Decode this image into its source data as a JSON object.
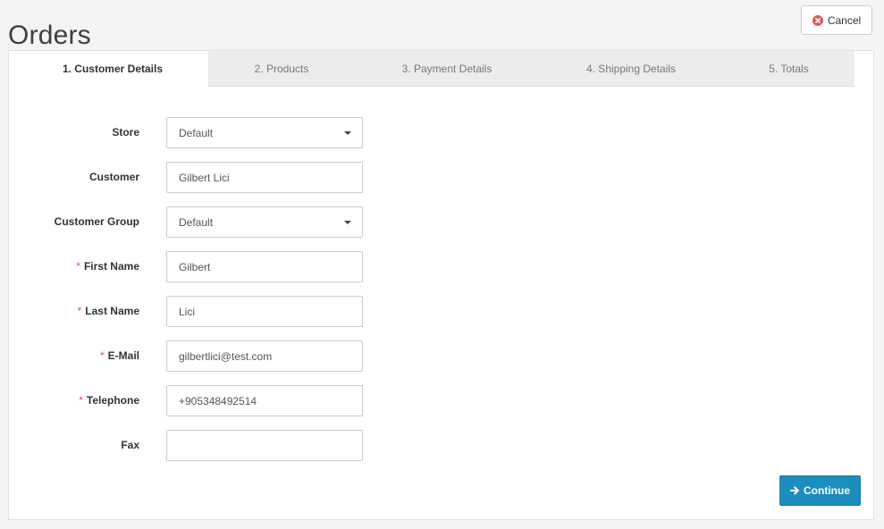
{
  "page": {
    "title": "Orders"
  },
  "header": {
    "cancel_label": "Cancel"
  },
  "tabs": [
    {
      "label": "1. Customer Details",
      "active": true
    },
    {
      "label": "2. Products",
      "active": false
    },
    {
      "label": "3. Payment Details",
      "active": false
    },
    {
      "label": "4. Shipping Details",
      "active": false
    },
    {
      "label": "5. Totals",
      "active": false
    }
  ],
  "form": {
    "store": {
      "label": "Store",
      "value": "Default",
      "required": false
    },
    "customer": {
      "label": "Customer",
      "value": "Gilbert Lici",
      "required": false
    },
    "customer_group": {
      "label": "Customer Group",
      "value": "Default",
      "required": false
    },
    "first_name": {
      "label": "First Name",
      "value": "Gilbert",
      "required": true
    },
    "last_name": {
      "label": "Last Name",
      "value": "Lici",
      "required": true
    },
    "email": {
      "label": "E-Mail",
      "value": "gilbertlici@test.com",
      "required": true
    },
    "telephone": {
      "label": "Telephone",
      "value": "+905348492514",
      "required": true
    },
    "fax": {
      "label": "Fax",
      "value": "",
      "required": false
    },
    "required_marker": "*"
  },
  "actions": {
    "continue_label": "Continue"
  },
  "colors": {
    "primary": "#1b8ebd",
    "required": "#d9534f",
    "cancel_icon": "#e05a5a"
  }
}
